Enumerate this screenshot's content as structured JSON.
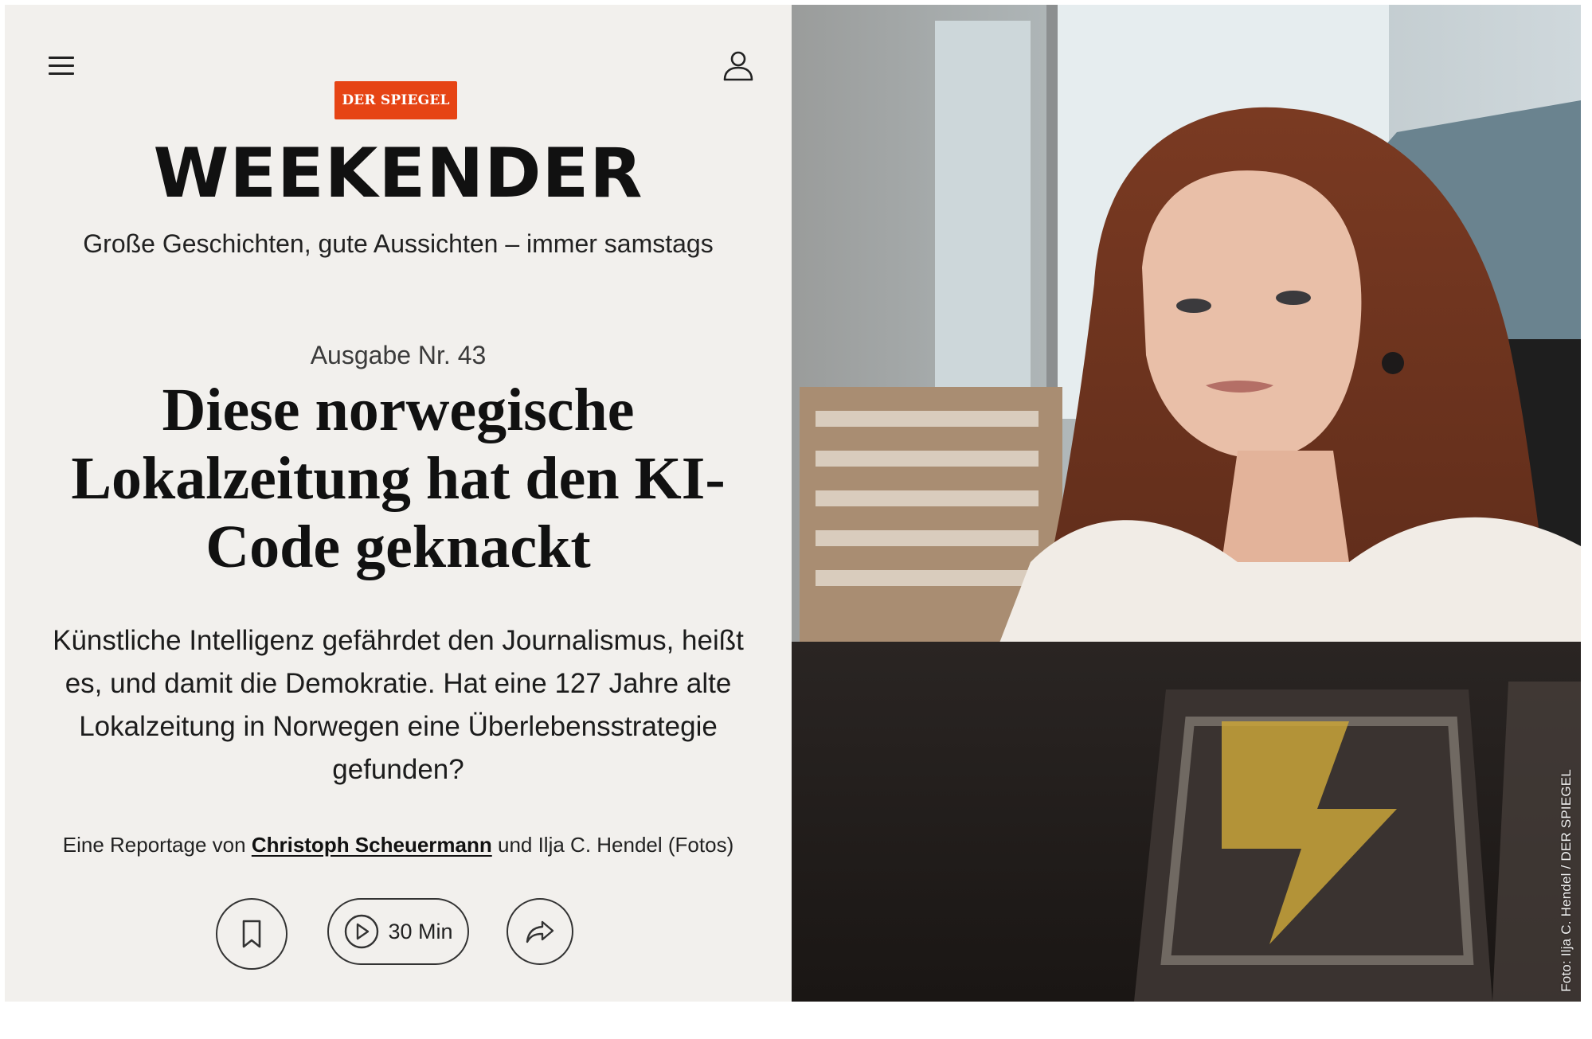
{
  "header": {
    "brand": "DER SPIEGEL",
    "title": "WEEKENDER",
    "tagline": "Große Geschichten, gute Aussichten – immer samstags",
    "menu_icon": "hamburger-menu-icon",
    "account_icon": "user-icon"
  },
  "article": {
    "issue": "Ausgabe Nr. 43",
    "headline": "Diese norwegische Lokalzeitung hat den KI-Code geknackt",
    "teaser": "Künstliche Intelligenz gefährdet den Journalismus, heißt es, und damit die Demokratie. Hat eine 127 Jahre alte Lokalzeitung in Norwegen eine Überlebensstrategie gefunden?",
    "byline": {
      "prefix": "Eine Reportage von",
      "author": "Christoph Scheuermann",
      "suffix": "und Ilja C. Hendel (Fotos)"
    },
    "actions": {
      "bookmark_icon": "bookmark-icon",
      "audio_label": "30 Min",
      "audio_icon": "play-icon",
      "share_icon": "share-icon"
    }
  },
  "photo": {
    "credit": "Foto: Ilja C. Hendel / DER SPIEGEL"
  },
  "colors": {
    "brand_red": "#e64415",
    "panel_bg": "#f2f0ed",
    "text": "#111111"
  }
}
